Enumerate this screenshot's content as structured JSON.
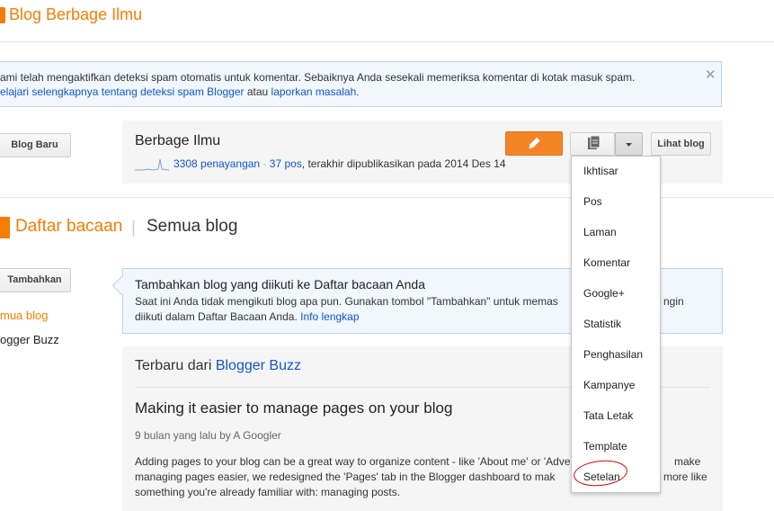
{
  "header": {
    "title": "Blog Berbage Ilmu"
  },
  "alert": {
    "line1": "ami telah mengaktifkan deteksi spam otomatis untuk komentar. Sebaiknya Anda sesekali memeriksa komentar di kotak masuk spam.",
    "learn_more_link": "elajari selengkapnya tentang deteksi spam Blogger",
    "or_text": " atau ",
    "report_link": "laporkan masalah",
    "period": "."
  },
  "left_buttons": {
    "new_blog": "Blog Baru",
    "add": "Tambahkan"
  },
  "blog": {
    "name": "Berbage Ilmu",
    "views_link": "3308 penayangan",
    "dash": " - ",
    "posts_link": "37 pos",
    "last_published": ", terakhir dipublikasikan pada 2014 Des 14",
    "view_blog_button": "Lihat blog"
  },
  "dropdown_menu": {
    "items": [
      "Ikhtisar",
      "Pos",
      "Laman",
      "Komentar",
      "Google+",
      "Statistik",
      "Penghasilan",
      "Kampanye",
      "Tata Letak",
      "Template",
      "Setelan"
    ]
  },
  "reading_list": {
    "title": "Daftar bacaan",
    "divider": "|",
    "subtitle": "Semua blog",
    "sidebar": [
      "mua blog",
      "ogger Buzz"
    ]
  },
  "info_box": {
    "title": "Tambahkan blog yang diikuti ke Daftar bacaan Anda",
    "text_line1": "Saat ini Anda tidak mengikuti blog apa pun. Gunakan tombol \"Tambahkan\" untuk memas",
    "text_line1_tail": "ngin",
    "text_line2": "diikuti dalam Daftar Bacaan Anda.",
    "info_link": "Info lengkap"
  },
  "latest": {
    "prefix": "Terbaru dari ",
    "source_link": "Blogger Buzz",
    "post_title": "Making it easier to manage pages on your blog",
    "meta": "9 bulan yang lalu by A Googler",
    "line1": "Adding pages to your blog can be a great way to organize content - like 'About me' or 'Adve",
    "line1_tail": "make",
    "line2": "managing pages easier, we redesigned the 'Pages' tab in the Blogger dashboard to mak",
    "line2_tail": "more like",
    "line3": "something you're already familiar with: managing posts."
  },
  "icons": {
    "edit": "pencil-icon",
    "pages": "pages-icon",
    "dropdown": "caret-down-icon",
    "close": "close-icon"
  },
  "colors": {
    "brand_orange": "#f57d00",
    "link_blue": "#1155cc",
    "annotation_red": "#e00000"
  }
}
